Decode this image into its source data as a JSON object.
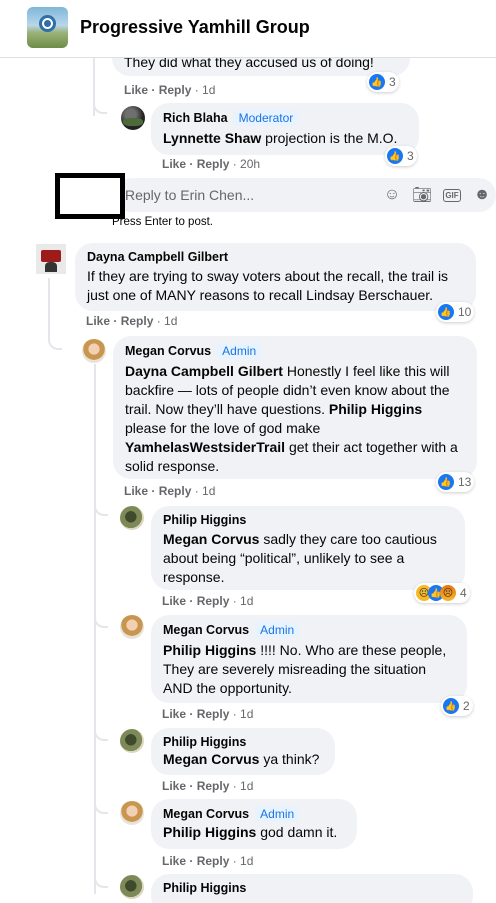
{
  "header": {
    "group_name": "Progressive Yamhill Group"
  },
  "labels": {
    "like": "Like",
    "reply": "Reply",
    "dot": " · "
  },
  "top_fragment": {
    "text": "They did what they accused us of doing!",
    "time": "1d",
    "reactions": "3"
  },
  "rich": {
    "author": "Rich Blaha",
    "badge": "Moderator",
    "mention": "Lynnette Shaw",
    "text": " projection is the M.O.",
    "time": "20h",
    "reactions": "3"
  },
  "reply_box": {
    "placeholder": "Reply to Erin Chen...",
    "hint": "Press Enter to post."
  },
  "dayna": {
    "author": "Dayna Campbell Gilbert",
    "text": "If they are trying to sway voters about the recall, the trail is just one of MANY reasons to recall Lindsay Berschauer.",
    "time": "1d",
    "reactions": "10"
  },
  "megan1": {
    "author": "Megan Corvus",
    "badge": "Admin",
    "mention1": "Dayna Campbell Gilbert",
    "text1": " Honestly I feel like this will backfire — lots of people didn’t even know about the trail. Now they’ll have questions. ",
    "mention2": "Philip Higgins",
    "text2": " please for the love of god make ",
    "mention3": "YamhelasWestsiderTrail",
    "text3": " get their act together with a solid response.",
    "time": "1d",
    "reactions": "13"
  },
  "philip1": {
    "author": "Philip Higgins",
    "mention": "Megan Corvus",
    "text": " sadly they care too cautious about being “political”, unlikely to see a response.",
    "time": "1d",
    "reactions": "4"
  },
  "megan2": {
    "author": "Megan Corvus",
    "badge": "Admin",
    "mention": "Philip Higgins",
    "text": " !!!! No. Who are these people, They are severely misreading the situation AND the opportunity.",
    "time": "1d",
    "reactions": "2"
  },
  "philip2": {
    "author": "Philip Higgins",
    "mention": "Megan Corvus",
    "text": " ya think?",
    "time": "1d"
  },
  "megan3": {
    "author": "Megan Corvus",
    "badge": "Admin",
    "mention": "Philip Higgins",
    "text": " god damn it.",
    "time": "1d"
  },
  "philip3": {
    "author": "Philip Higgins"
  }
}
